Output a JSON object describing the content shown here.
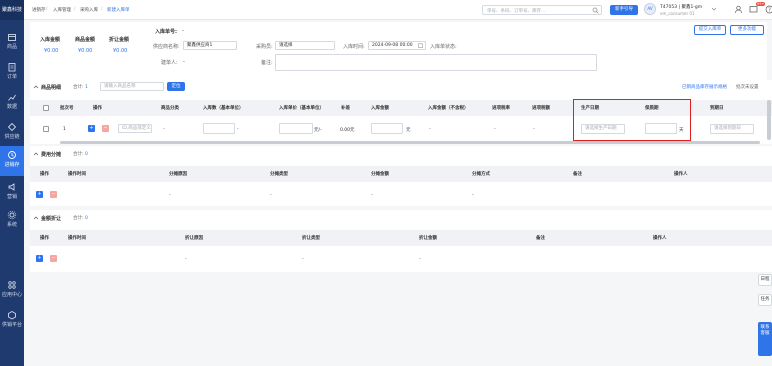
{
  "brand": "聚鑫科技",
  "sidebar": {
    "items": [
      {
        "label": "商品",
        "icon": "box-icon"
      },
      {
        "label": "订单",
        "icon": "order-icon"
      },
      {
        "label": "数据",
        "icon": "chart-icon"
      },
      {
        "label": "供应链",
        "icon": "supply-icon"
      },
      {
        "label": "进销存",
        "icon": "inventory-icon"
      },
      {
        "label": "营销",
        "icon": "marketing-icon"
      },
      {
        "label": "系统",
        "icon": "gear-icon"
      },
      {
        "label": "应用中心",
        "icon": "apps-icon"
      },
      {
        "label": "供销平台",
        "icon": "platform-icon"
      }
    ]
  },
  "topbar": {
    "breadcrumb": [
      "进销存",
      "入库管理",
      "采购入库",
      "新建入库单"
    ],
    "search_placeholder": "单号、条码、订单号、库存...",
    "guide_btn": "新手引导",
    "avatar": "AV",
    "account_line1": "T47053 | 聚鑫1-gm",
    "account_line2": "om_consumer 01",
    "notif_count": "99+"
  },
  "header": {
    "order_no_label": "入库单号:",
    "order_no_value": "-",
    "stats": [
      {
        "label": "入库金额",
        "value": "¥0.00"
      },
      {
        "label": "商品金额",
        "value": "¥0.00"
      },
      {
        "label": "折让金额",
        "value": "¥0.00"
      }
    ],
    "supplier_label": "供应商名称:",
    "supplier_value": "聚鑫供应商1",
    "buyer_label": "采购员:",
    "buyer_value": "请选择",
    "time_label": "入库时间:",
    "time_value": "2024-09-08 00:00",
    "status_label": "入库单状态:",
    "operator_label": "建单人:",
    "operator_value": "-",
    "remark_label": "备注:",
    "submit_btn": "提交入库单",
    "more_btn": "更多功能"
  },
  "goods": {
    "title": "商品明细",
    "count_label": "合计:",
    "count_value": "1",
    "search_placeholder": "请输入商品名称",
    "locate_btn": "定位",
    "link_note": "已销商品库存展示规格",
    "header_note": "批次未设置",
    "columns": [
      "批次号",
      "操作",
      "商品分类",
      "入库数（基本单位）",
      "入库单价（基本单位）",
      "补差",
      "入库金额",
      "入库金额（不含税）",
      "进项税率",
      "进项税额",
      "生产日期",
      "保质期",
      "到期日"
    ],
    "row": {
      "batch": "1",
      "product_placeholder": "ID,商品或定义",
      "category": "-",
      "qty_unit": "-",
      "price_unit": "元/-",
      "diff": "0.00元",
      "amount_unit": "元",
      "amount_excl": "-",
      "tax_rate": "-",
      "tax_amount": "-",
      "prod_date_placeholder": "请选择生产日期",
      "shelf_unit": "天",
      "expiry_placeholder": "请选择到期日"
    }
  },
  "fees": {
    "title": "费用分摊",
    "count_label": "合计:",
    "count_value": "0",
    "columns": [
      "操作",
      "操作时间",
      "分摊原因",
      "分摊类型",
      "分摊金额",
      "分摊方式",
      "备注",
      "操作人"
    ],
    "row": [
      "-",
      "-",
      "-",
      "-"
    ]
  },
  "discount": {
    "title": "金额折让",
    "count_label": "合计:",
    "count_value": "0",
    "columns": [
      "操作",
      "操作时间",
      "折让原因",
      "折让类型",
      "折让金额",
      "备注",
      "操作人"
    ],
    "row": [
      "-",
      "-",
      "-"
    ]
  },
  "side_tabs": [
    "日程",
    "任务",
    "联系客服"
  ]
}
